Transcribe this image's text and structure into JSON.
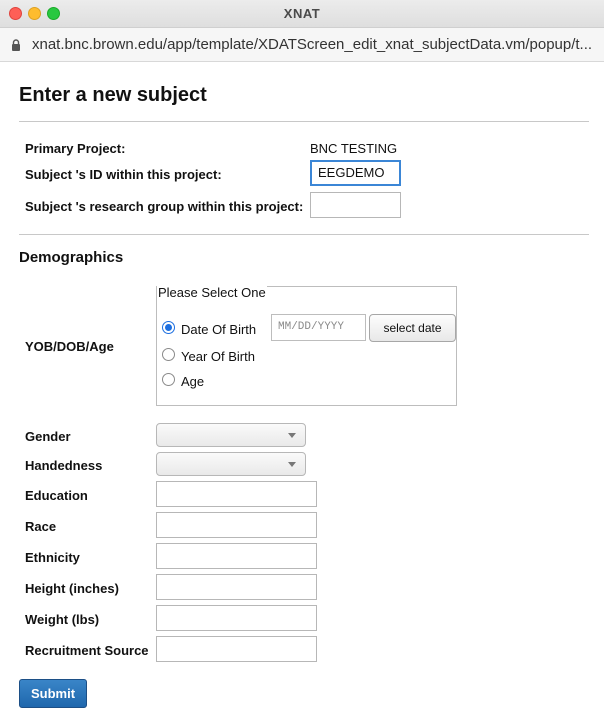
{
  "window": {
    "title": "XNAT"
  },
  "browser": {
    "url": "xnat.bnc.brown.edu/app/template/XDATScreen_edit_xnat_subjectData.vm/popup/t..."
  },
  "page": {
    "heading": "Enter a new subject",
    "primary_project_label": "Primary Project:",
    "primary_project_value": "BNC TESTING",
    "subject_id_label": "Subject 's ID within this project:",
    "subject_id_value": "EEGDEMO",
    "research_group_label": "Subject 's research group within this project:",
    "research_group_value": ""
  },
  "demographics": {
    "heading": "Demographics",
    "yob_label": "YOB/DOB/Age",
    "fieldset_legend": "Please Select One",
    "options": [
      "Date Of Birth",
      "Year Of Birth",
      "Age"
    ],
    "selected_option": "Date Of Birth",
    "date_placeholder": "MM/DD/YYYY",
    "select_date_button": "select date",
    "fields": [
      {
        "label": "Gender",
        "kind": "select",
        "value": ""
      },
      {
        "label": "Handedness",
        "kind": "select",
        "value": ""
      },
      {
        "label": "Education",
        "kind": "text",
        "value": ""
      },
      {
        "label": "Race",
        "kind": "text",
        "value": ""
      },
      {
        "label": "Ethnicity",
        "kind": "text",
        "value": ""
      },
      {
        "label": "Height (inches)",
        "kind": "text",
        "value": ""
      },
      {
        "label": "Weight (lbs)",
        "kind": "text",
        "value": ""
      },
      {
        "label": "Recruitment Source",
        "kind": "text",
        "value": ""
      }
    ]
  },
  "actions": {
    "submit_label": "Submit"
  },
  "colors": {
    "accent": "#1f67ad",
    "focus": "#3b86d6",
    "radio": "#1d6fe0"
  }
}
